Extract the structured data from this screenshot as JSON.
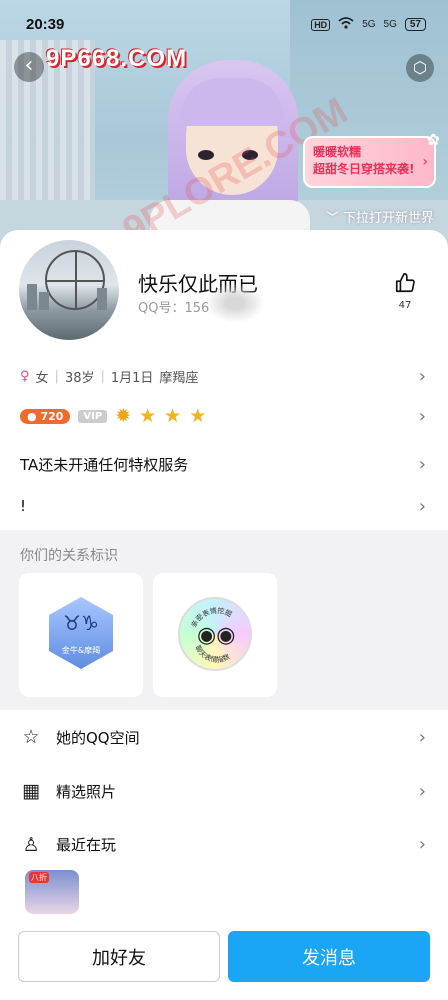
{
  "status_bar": {
    "time": "20:39",
    "hd": "HD",
    "signal1": "5G",
    "signal2": "5G",
    "battery": "57"
  },
  "header": {
    "back_icon": "chevron-left-icon",
    "watermark": "9P668.COM",
    "overlay_watermark": "9PLORE.COM",
    "promo_line1": "暖暖软糯",
    "promo_line2": "超甜冬日穿搭来袭!",
    "pull_hint": "下拉打开新世界"
  },
  "profile": {
    "name": "快乐仅此而已",
    "qq_label": "QQ号：",
    "qq_number": "156",
    "like_count": "47",
    "gender_symbol": "♀",
    "gender": "女",
    "age": "38岁",
    "birthday": "1月1日",
    "zodiac": "摩羯座",
    "coin_level": "720",
    "vip_label": "VIP",
    "privilege_text": "TA还未开通任何特权服务",
    "signature": "!"
  },
  "relation": {
    "title": "你们的关系标识",
    "card1_symbols": "♉♑",
    "card1_label": "金牛&摩羯",
    "card2_top": "亲密表情挖掘",
    "card2_bottom": "聊天表情指数"
  },
  "menu": {
    "qzone": "她的QQ空间",
    "photos": "精选照片",
    "recent_play": "最近在玩",
    "game_tag": "八折"
  },
  "actions": {
    "add_friend": "加好友",
    "send_message": "发消息"
  },
  "colors": {
    "primary": "#1aa5f5",
    "accent_pink": "#e2498c",
    "coin_orange": "#f06a2b"
  }
}
